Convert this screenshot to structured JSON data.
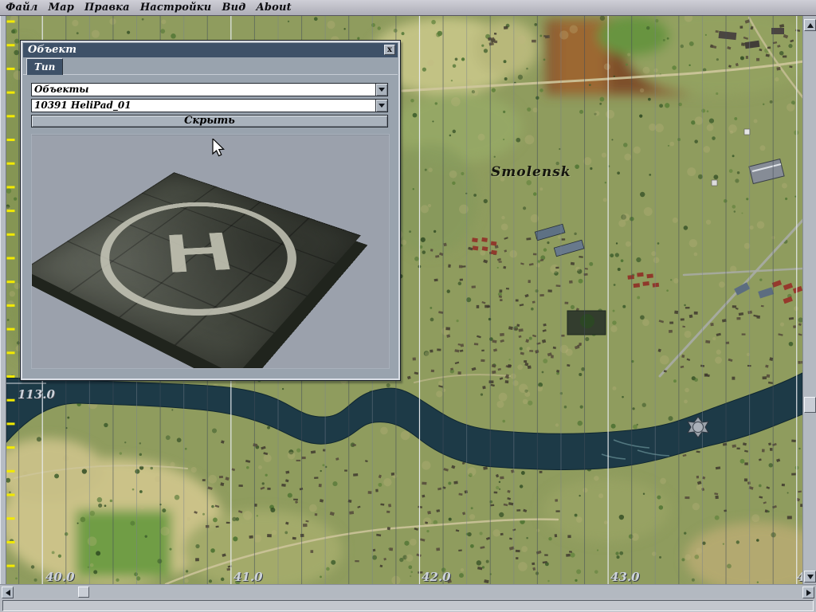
{
  "menu": {
    "items": [
      {
        "label": "Файл"
      },
      {
        "label": "Мар"
      },
      {
        "label": "Правка"
      },
      {
        "label": "Настройки"
      },
      {
        "label": "Вид"
      },
      {
        "label": "About"
      }
    ]
  },
  "dialog": {
    "title": "Объект",
    "close_label": "x",
    "tab_label": "Тип",
    "category_select": {
      "value": "Объекты"
    },
    "object_select": {
      "value": "10391 HeliPad_01"
    },
    "hide_button_label": "Скрыть",
    "helipad_letter": "H"
  },
  "map": {
    "city_label": "Smolensk",
    "lat_label": "113.0",
    "lon_labels": [
      "40.0",
      "41.0",
      "42.0",
      "43.0",
      "4"
    ]
  },
  "status": {
    "text": ""
  },
  "colors": {
    "titlebar": "#3e5168",
    "dialog_body": "#99a3ae",
    "river": "#1d3a47",
    "grid_major": "#e9edf2",
    "tick_yellow": "#f2ea00",
    "map_base": "#8f9c5e"
  }
}
